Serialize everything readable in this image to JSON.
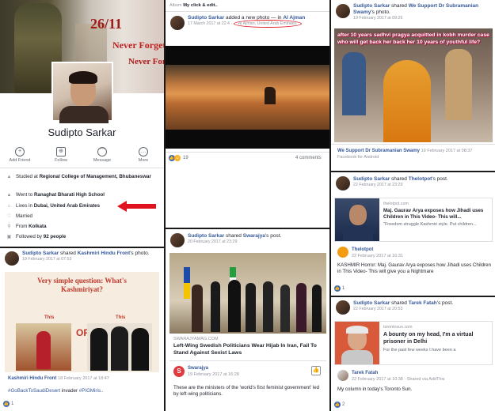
{
  "profile": {
    "cover_text_line1": "26/11",
    "cover_text_line2": "Never Forget",
    "cover_text_line3": "Never Forgive",
    "name": "Sudipto Sarkar",
    "actions": [
      {
        "label": "Add Friend",
        "icon": "add-friend-icon"
      },
      {
        "label": "Follow",
        "icon": "follow-icon"
      },
      {
        "label": "Message",
        "icon": "message-icon"
      },
      {
        "label": "More",
        "icon": "more-icon"
      }
    ],
    "studied_prefix": "Studied at ",
    "studied_at": "Regional College of Management, Bhubaneswar",
    "went_prefix": "Went to ",
    "went_to": "Ranaghat Bharati High School",
    "lives_prefix": "Lives in ",
    "lives_in": "Dubai, United Arab Emirates",
    "relationship": "Married",
    "from_prefix": "From ",
    "from": "Kolkata",
    "followed_prefix": "Followed by ",
    "followed_count": "92 people",
    "arrow_color": "#e0141e"
  },
  "post_album": {
    "album_prefix": "Album",
    "album_name": "My click & edit..",
    "author": "Sudipto Sarkar",
    "action": " added a new photo — in ",
    "place": "Al Ajman",
    "time": "17 March 2017 at 22:4",
    "location_meta": "Al Ajman, United Arab Emirates",
    "reactions": "19",
    "comments": "4 comments"
  },
  "post_swamy": {
    "author": "Sudipto Sarkar",
    "action": " shared ",
    "page": "We Support Dr Subramanian Swamy",
    "suffix": "'s photo.",
    "time": "19 February 2017 at 09:26",
    "overlay_text": "after 10 years sadhvi pragya acquitted in kobh murder case who will get back her back her 10 years of youthful life?",
    "footer_page": "We Support Dr Subramanian Swamy",
    "footer_time": "19 February 2017 at 08:37",
    "footer_source": "Facebook for Android"
  },
  "post_kashmiri": {
    "author": "Sudipto Sarkar",
    "action": " shared ",
    "page": "Kashmiri Hindu Front",
    "suffix": "'s photo.",
    "time": "19 February 2017 at 07:53",
    "card_title": "Very simple question: What's Kashmiriyat?",
    "label_this": "This",
    "label_or": "OR",
    "label_this2": "This",
    "footer_page": "Kashmiri Hindu Front",
    "footer_time": "18 February 2017 at 18:47",
    "caption_tag1": "#GoBackToSaudiDesert",
    "caption_text": " invader ",
    "caption_tag2": "#PIGMiris..",
    "reactions": "1"
  },
  "post_swarajya": {
    "author": "Sudipto Sarkar",
    "action": " shared ",
    "page": "Swarajya",
    "suffix": "'s post.",
    "time": "20 February 2017 at 23:29",
    "domain": "swarajyamag.com",
    "headline": "Left-Wing Swedish Politicians Wear Hijab In Iran, Fail To Stand Against Sexist Laws",
    "footer_page": "Swarajya",
    "footer_time": "19 February 2017 at 16:28",
    "caption": "These are the ministers of the 'world's first feminist government' led by left-wing politicians.",
    "reactions": "1"
  },
  "post_thelotpot": {
    "author": "Sudipto Sarkar",
    "action": " shared ",
    "page": "Thelotpot",
    "suffix": "'s post.",
    "time": "22 February 2017 at 23:29",
    "domain": "thelotpot.com",
    "link_title": "Maj. Gaurav Arya exposes how Jihadi uses Children in This Video- This will...",
    "link_desc": "\"Freedom struggle Kashmiri style. Put children...",
    "footer_page": "Thelotpot",
    "footer_time": "22 February 2017 at 16:31",
    "caption": "KASHMIR Horror: Maj. Gaurav Arya exposes how Jihadi uses Children in This Video- This will give you a Nightmare",
    "reactions": "1"
  },
  "post_tarek": {
    "author": "Sudipto Sarkar",
    "action": " shared ",
    "page": "Tarek Fatah",
    "suffix": "'s post.",
    "time": "22 February 2017 at 20:53",
    "domain": "torontosun.com",
    "link_title": "A bounty on my head, I'm a virtual prisoner in Delhi",
    "link_desc": "For the past few weeks I have been a",
    "footer_page": "Tarek Fatah",
    "footer_time": "22 February 2017 at 10:38",
    "footer_source": "Shared via AddThis",
    "caption": "My column in today's Toronto Sun.",
    "reactions": "2"
  }
}
